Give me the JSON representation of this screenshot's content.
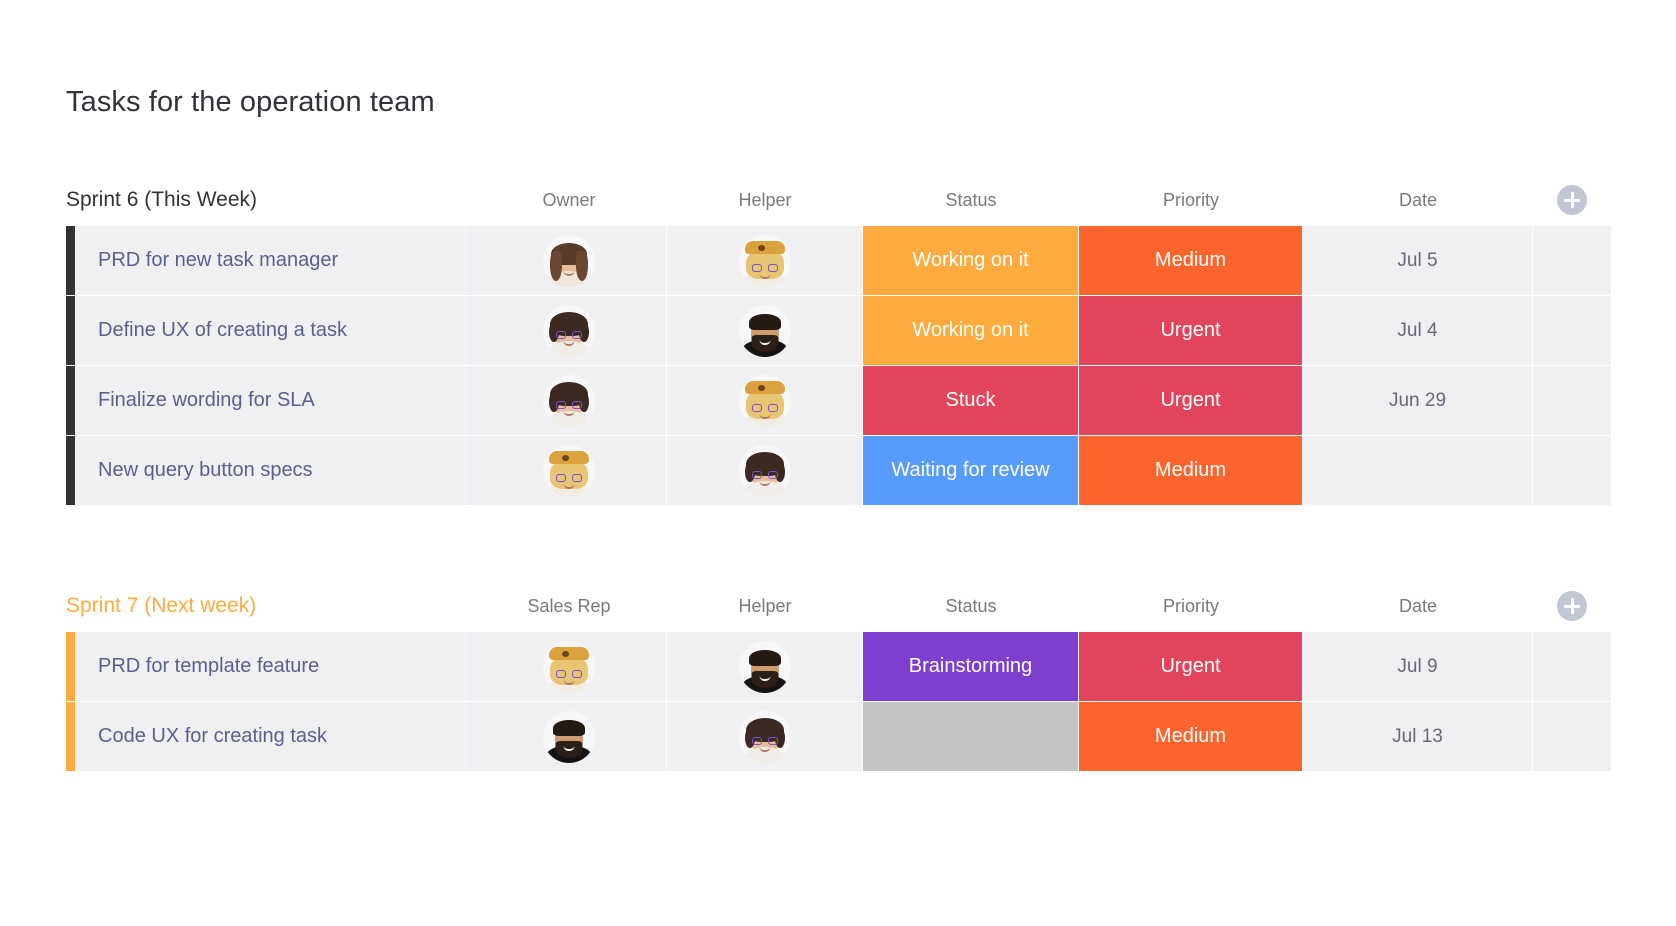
{
  "page": {
    "title": "Tasks for the operation team"
  },
  "colors": {
    "working_on_it": "#fdab3d",
    "stuck": "#e2445c",
    "waiting_for_review": "#579bfc",
    "brainstorming": "#7e3ece",
    "empty_status": "#c4c4c4",
    "urgent": "#e2445c",
    "medium": "#fb642d",
    "accent_sprint6": "#333333",
    "accent_sprint7": "#fdab3d",
    "sprint7_title": "#fdab3d",
    "cell_bg": "#f0f0f2",
    "task_text": "#5c5f8e",
    "header_text": "#7a7a7a"
  },
  "groups": [
    {
      "id": "sprint-6",
      "title": "Sprint 6 (This Week)",
      "title_color": "#323338",
      "accent": "#333333",
      "add_button_icon": "plus-icon",
      "columns": [
        "Owner",
        "Helper",
        "Status",
        "Priority",
        "Date"
      ],
      "rows": [
        {
          "task": "PRD for new task manager",
          "owner_avatar": "av-brown",
          "helper_avatar": "av-blonde",
          "status": "Working on it",
          "status_color": "#fdab3d",
          "priority": "Medium",
          "priority_color": "#fb642d",
          "date": "Jul 5"
        },
        {
          "task": "Define UX of creating a task",
          "owner_avatar": "av-glasses",
          "helper_avatar": "av-man",
          "status": "Working on it",
          "status_color": "#fdab3d",
          "priority": "Urgent",
          "priority_color": "#e2445c",
          "date": "Jul 4"
        },
        {
          "task": "Finalize wording for SLA",
          "owner_avatar": "av-glasses",
          "helper_avatar": "av-blonde",
          "status": "Stuck",
          "status_color": "#e2445c",
          "priority": "Urgent",
          "priority_color": "#e2445c",
          "date": "Jun 29"
        },
        {
          "task": "New query button specs",
          "owner_avatar": "av-blonde",
          "helper_avatar": "av-glasses",
          "status": "Waiting for review",
          "status_color": "#579bfc",
          "priority": "Medium",
          "priority_color": "#fb642d",
          "date": ""
        }
      ]
    },
    {
      "id": "sprint-7",
      "title": "Sprint 7 (Next week)",
      "title_color": "#fdab3d",
      "accent": "#fdab3d",
      "add_button_icon": "plus-icon",
      "columns": [
        "Sales Rep",
        "Helper",
        "Status",
        "Priority",
        "Date"
      ],
      "rows": [
        {
          "task": "PRD for template feature",
          "owner_avatar": "av-blonde",
          "helper_avatar": "av-man",
          "status": "Brainstorming",
          "status_color": "#7e3ece",
          "priority": "Urgent",
          "priority_color": "#e2445c",
          "date": "Jul 9"
        },
        {
          "task": "Code UX for creating task",
          "owner_avatar": "av-man",
          "helper_avatar": "av-glasses",
          "status": "",
          "status_color": "#c4c4c4",
          "priority": "Medium",
          "priority_color": "#fb642d",
          "date": "Jul 13"
        }
      ]
    }
  ]
}
